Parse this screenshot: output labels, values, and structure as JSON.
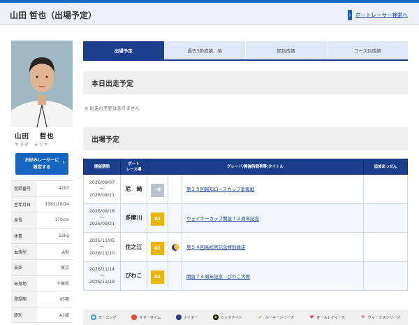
{
  "header": {
    "title": "山田 哲也（出場予定）",
    "link_label": "ボートレーサー検索へ"
  },
  "profile": {
    "name": "山田　 哲也",
    "kana": "ヤマダ　テツヤ",
    "favorite_button": [
      "お好みレーサーに",
      "設定する"
    ],
    "rows": [
      {
        "label": "登録番号",
        "value": "4297"
      },
      {
        "label": "生年月日",
        "value": "1982/10/14"
      },
      {
        "label": "身長",
        "value": "170cm"
      },
      {
        "label": "体重",
        "value": "52kg"
      },
      {
        "label": "血液型",
        "value": "A型"
      },
      {
        "label": "支部",
        "value": "東京"
      },
      {
        "label": "出身地",
        "value": "千葉県"
      },
      {
        "label": "登録期",
        "value": "95期"
      },
      {
        "label": "級別",
        "value": "A1級"
      }
    ]
  },
  "tabs": [
    "出場予定",
    "過去3節成績、他",
    "期別成績",
    "コース別成績"
  ],
  "today": {
    "heading": "本日出走予定",
    "empty_message": "※ 出走の予定はありません"
  },
  "schedule": {
    "heading": "出場予定",
    "columns": {
      "period": "開催期間",
      "venue": [
        "ボート",
        "レース場"
      ],
      "title": "グレード/開催時間帯等/タイトル",
      "extra": "追加あっせん"
    },
    "rows": [
      {
        "start": "2026/09/07",
        "sep": "〜",
        "end": "2026/09/11",
        "venue": "尼　崎",
        "grade": "一般",
        "time_icon": "",
        "title": "第２５回報知ローズカップ争奪戦"
      },
      {
        "start": "2026/09/16",
        "sep": "〜",
        "end": "2026/09/21",
        "venue": "多摩川",
        "grade": "G1",
        "time_icon": "",
        "title": "ウェイキーカップ開設７２周年記念"
      },
      {
        "start": "2026/11/05",
        "sep": "〜",
        "end": "2026/11/10",
        "venue": "住之江",
        "grade": "G1",
        "time_icon": "nighter-icon",
        "title": "第５４回高松宮記念特別競走"
      },
      {
        "start": "2026/11/14",
        "sep": "〜",
        "end": "2026/11/19",
        "venue": "びわこ",
        "grade": "G1",
        "time_icon": "",
        "title": "開設７４周年記念　びわこ大賞"
      }
    ]
  },
  "legend": [
    {
      "icon": "morning-icon",
      "label": "モーニング",
      "color": "#2aa3d9"
    },
    {
      "icon": "summertime-icon",
      "label": "サマータイム",
      "color": "#e8452c"
    },
    {
      "icon": "nighter-icon",
      "label": "ナイター",
      "color": "#2b3a8f"
    },
    {
      "icon": "midnight-icon",
      "label": "ミッドナイト",
      "color": "#111111"
    },
    {
      "icon": "rookie-icon",
      "label": "ルーキーシリーズ",
      "color": "#6cbf3a"
    },
    {
      "icon": "ladies-icon",
      "label": "オールレディース",
      "color": "#e8508a"
    },
    {
      "icon": "venus-icon",
      "label": "ヴィーナスシリーズ",
      "color": "#f08db0"
    }
  ],
  "colors": {
    "primary": "#1565c0",
    "navy": "#1a3e8c",
    "g1": "#e8b60a"
  }
}
